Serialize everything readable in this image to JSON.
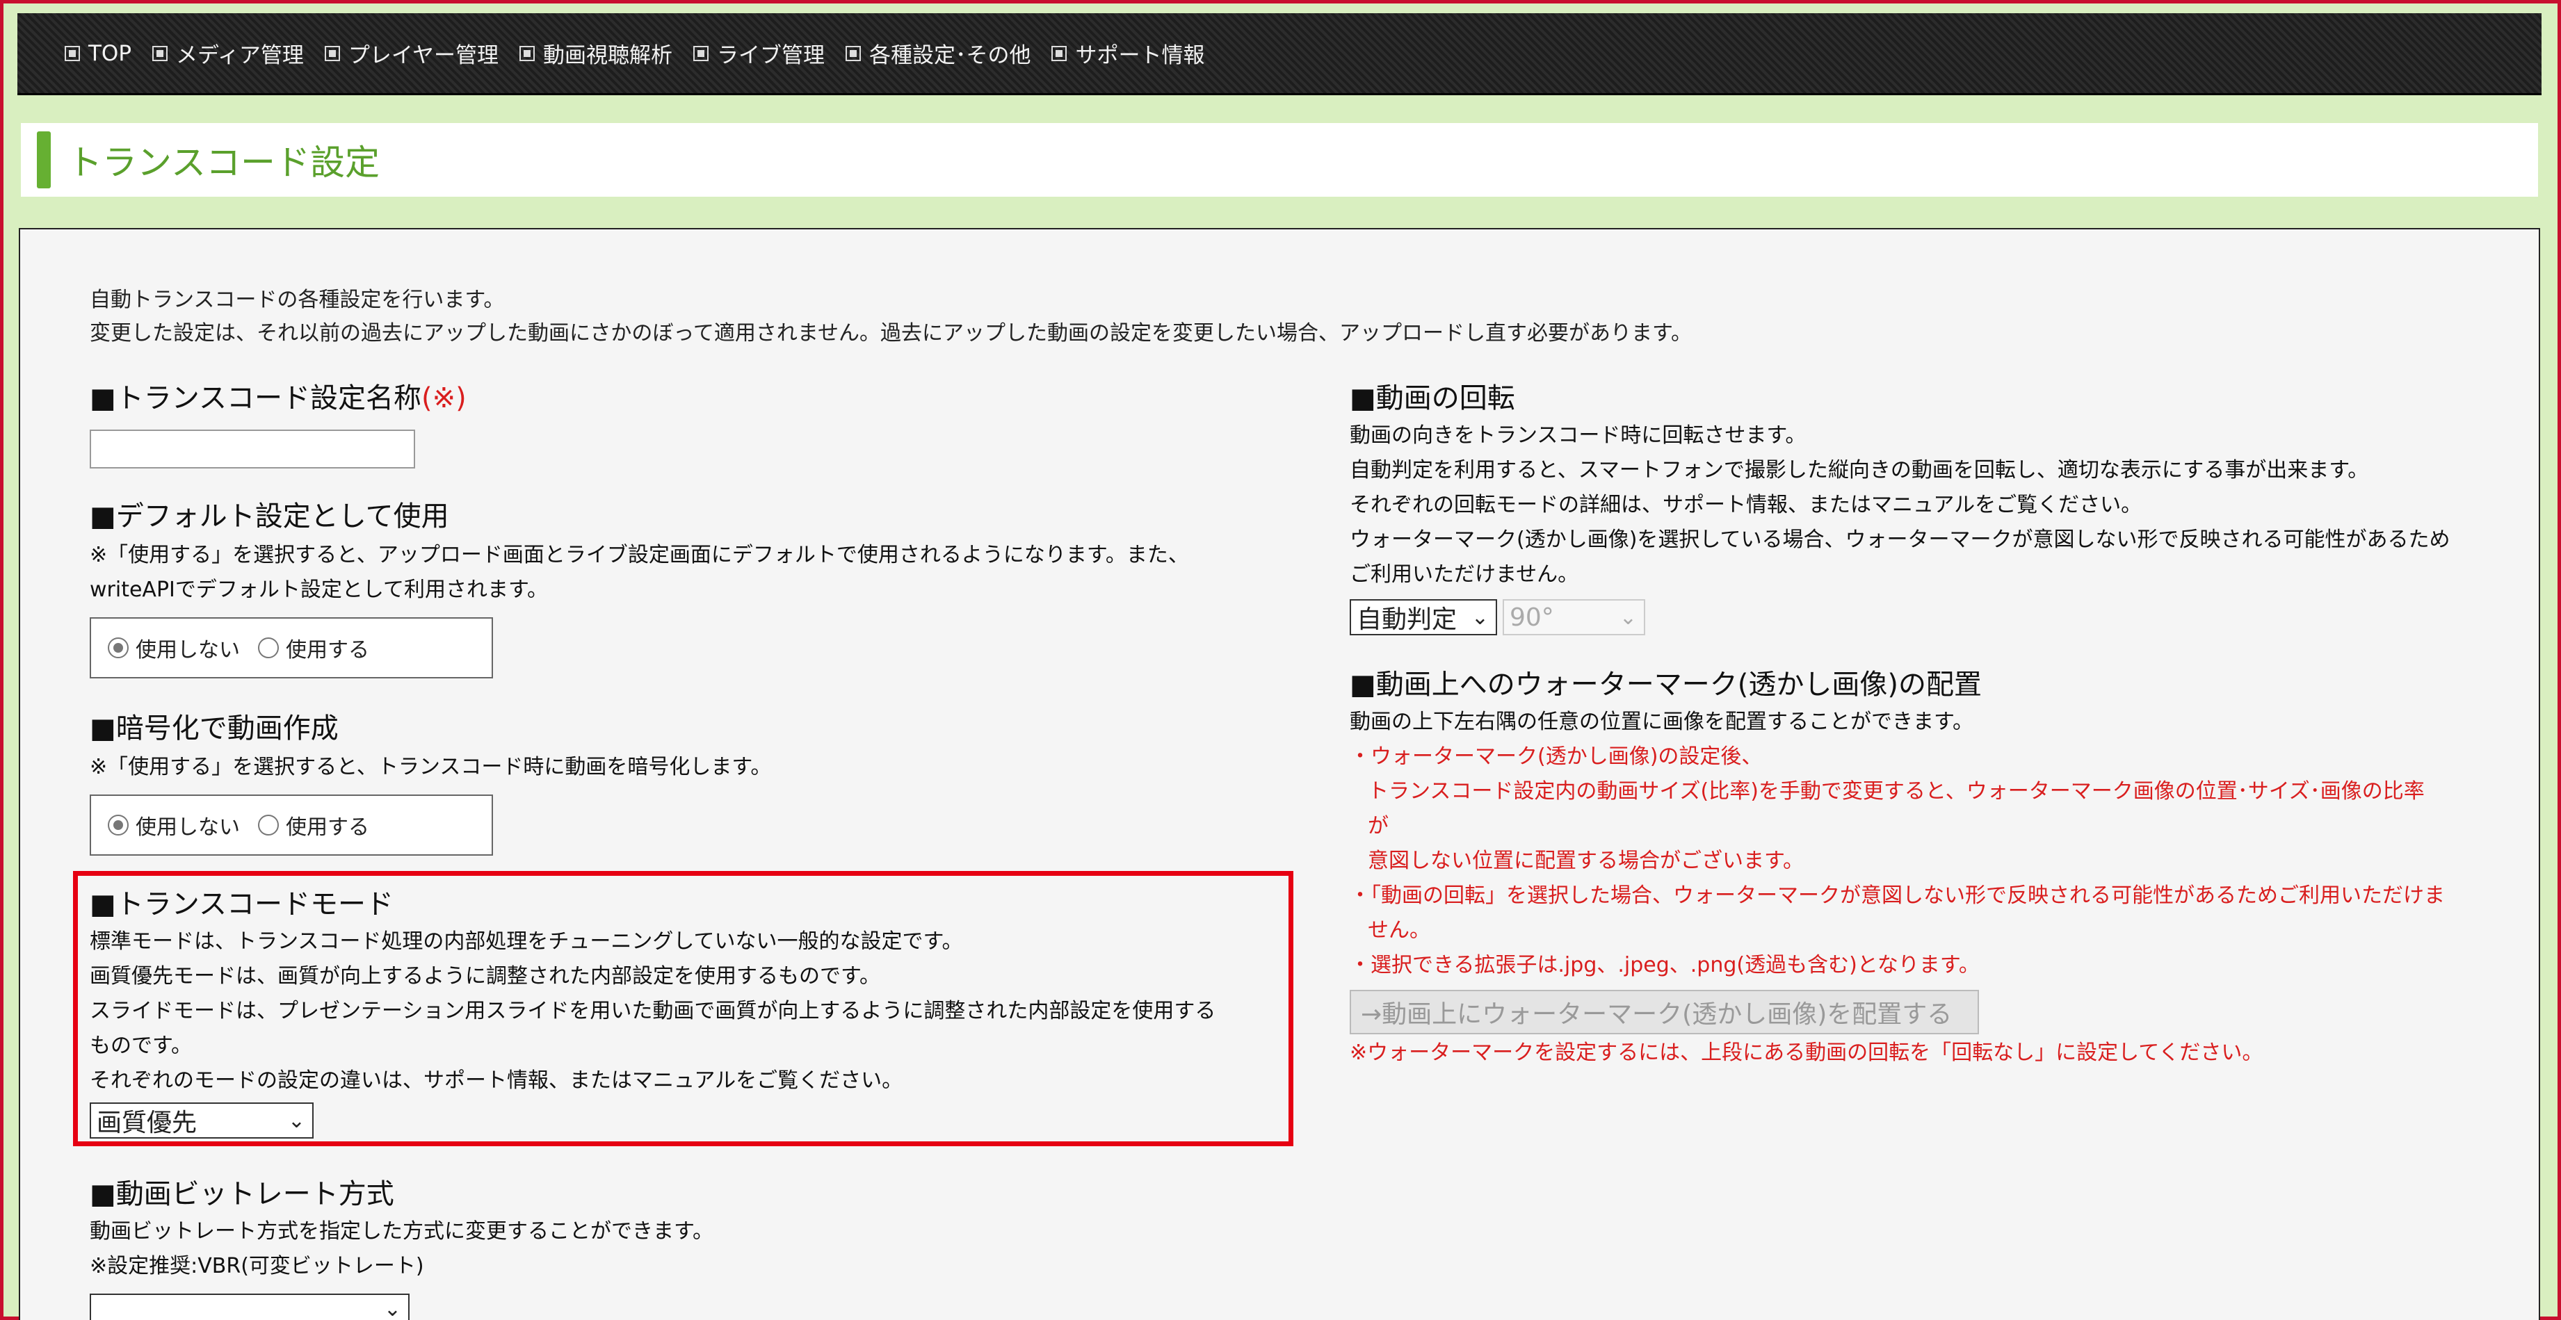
{
  "nav": {
    "items": [
      {
        "label": "TOP"
      },
      {
        "label": "メディア管理"
      },
      {
        "label": "プレイヤー管理"
      },
      {
        "label": "動画視聴解析"
      },
      {
        "label": "ライブ管理"
      },
      {
        "label": "各種設定･その他"
      },
      {
        "label": "サポート情報"
      }
    ]
  },
  "page": {
    "title": "トランスコード設定"
  },
  "intro": {
    "line1": "自動トランスコードの各種設定を行います。",
    "line2": "変更した設定は、それ以前の過去にアップした動画にさかのぼって適用されません。過去にアップした動画の設定を変更したい場合、アップロードし直す必要があります。"
  },
  "name_section": {
    "heading": "■トランスコード設定名称",
    "required_mark": "(※)",
    "value": ""
  },
  "default_section": {
    "heading": "■デフォルト設定として使用",
    "note1": "※「使用する」を選択すると、アップロード画面とライブ設定画面にデフォルトで使用されるようになります。また、",
    "note2": "writeAPIでデフォルト設定として利用されます。",
    "opt_off": "使用しない",
    "opt_on": "使用する"
  },
  "encrypt_section": {
    "heading": "■暗号化で動画作成",
    "note": "※「使用する」を選択すると、トランスコード時に動画を暗号化します。",
    "opt_off": "使用しない",
    "opt_on": "使用する"
  },
  "mode_section": {
    "heading": "■トランスコードモード",
    "line1": "標準モードは、トランスコード処理の内部処理をチューニングしていない一般的な設定です。",
    "line2": "画質優先モードは、画質が向上するように調整された内部設定を使用するものです。",
    "line3": "スライドモードは、プレゼンテーション用スライドを用いた動画で画質が向上するように調整された内部設定を使用する",
    "line4": "ものです。",
    "line5": "それぞれのモードの設定の違いは、サポート情報、またはマニュアルをご覧ください。",
    "selected": "画質優先"
  },
  "bitrate_section": {
    "heading": "■動画ビットレート方式",
    "line1": "動画ビットレート方式を指定した方式に変更することができます。",
    "line2": "※設定推奨:VBR(可変ビットレート)",
    "selected": ""
  },
  "rotation_section": {
    "heading": "■動画の回転",
    "line1": "動画の向きをトランスコード時に回転させます。",
    "line2": "自動判定を利用すると、スマートフォンで撮影した縦向きの動画を回転し、適切な表示にする事が出来ます。",
    "line3": "それぞれの回転モードの詳細は、サポート情報、またはマニュアルをご覧ください。",
    "line4": "ウォーターマーク(透かし画像)を選択している場合、ウォーターマークが意図しない形で反映される可能性があるため",
    "line5": "ご利用いただけません。",
    "mode_selected": "自動判定",
    "angle_selected": "90°"
  },
  "watermark_section": {
    "heading": "■動画上へのウォーターマーク(透かし画像)の配置",
    "line1": "動画の上下左右隅の任意の位置に画像を配置することができます。",
    "red1": "・ウォーターマーク(透かし画像)の設定後、",
    "red2": "トランスコード設定内の動画サイズ(比率)を手動で変更すると、ウォーターマーク画像の位置･サイズ･画像の比率",
    "red3": "が",
    "red4": "意図しない位置に配置する場合がございます。",
    "red5": "・「動画の回転」を選択した場合、ウォーターマークが意図しない形で反映される可能性があるためご利用いただけま",
    "red6": "せん。",
    "red7": "・選択できる拡張子は.jpg、.jpeg、.png(透過も含む)となります。",
    "button_label": "→動画上にウォーターマーク(透かし画像)を配置する",
    "note": "※ウォーターマークを設定するには、上段にある動画の回転を「回転なし」に設定してください。"
  },
  "colors": {
    "accent_green": "#66b032",
    "title_green": "#5aa02c",
    "alert_red": "#d91e1e",
    "highlight_red": "#e60012"
  }
}
